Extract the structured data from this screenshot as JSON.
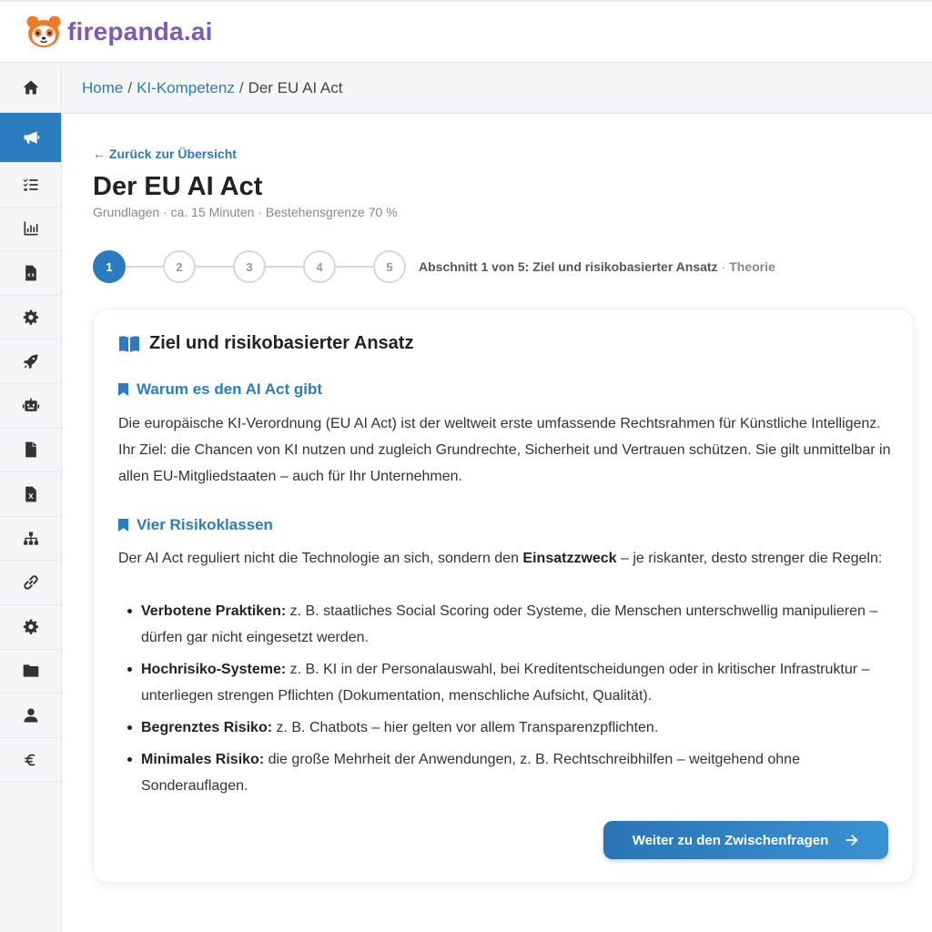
{
  "brand": {
    "name_part1": "fire",
    "name_part2": "panda",
    "name_part3": ".ai",
    "color": "#7a5bb5"
  },
  "breadcrumb": {
    "home": "Home",
    "section": "KI-Kompetenz",
    "current": "Der EU AI Act",
    "separator": "/"
  },
  "sidebar": {
    "items": [
      {
        "icon": "home-icon"
      },
      {
        "icon": "megaphone-icon",
        "active": true
      },
      {
        "icon": "checklist-icon"
      },
      {
        "icon": "bar-chart-icon"
      },
      {
        "icon": "file-code-icon"
      },
      {
        "icon": "gear-icon"
      },
      {
        "icon": "rocket-icon"
      },
      {
        "icon": "robot-icon"
      },
      {
        "icon": "file-icon"
      },
      {
        "icon": "file-excel-icon"
      },
      {
        "icon": "sitemap-icon"
      },
      {
        "icon": "link-icon"
      },
      {
        "icon": "gear-icon"
      },
      {
        "icon": "folder-icon"
      },
      {
        "icon": "user-icon"
      },
      {
        "icon": "euro-icon"
      }
    ]
  },
  "lesson": {
    "back_label": "← Zurück zur Übersicht",
    "title": "Der EU AI Act",
    "meta": "Grundlagen · ca. 15 Minuten · Bestehensgrenze 70 %",
    "steps": [
      "1",
      "2",
      "3",
      "4",
      "5"
    ],
    "active_step": 1,
    "step_caption": "Abschnitt 1 von 5: Ziel und risikobasierter Ansatz",
    "step_separator": "·",
    "step_type": "Theorie"
  },
  "card": {
    "title": "Ziel und risikobasierter Ansatz",
    "section1": {
      "heading": "Warum es den AI Act gibt",
      "text": "Die europäische KI-Verordnung (EU AI Act) ist der weltweit erste umfassende Rechtsrahmen für Künstliche Intelligenz. Ihr Ziel: die Chancen von KI nutzen und zugleich Grundrechte, Sicherheit und Vertrauen schützen. Sie gilt unmittelbar in allen EU-Mitgliedstaaten – auch für Ihr Unternehmen."
    },
    "section2": {
      "heading": "Vier Risikoklassen",
      "intro_before": "Der AI Act reguliert nicht die Technologie an sich, sondern den ",
      "intro_bold": "Einsatzzweck",
      "intro_after": " – je riskanter, desto strenger die Regeln:",
      "items": [
        {
          "term": "Verbotene Praktiken:",
          "text": " z. B. staatliches Social Scoring oder Systeme, die Menschen unterschwellig manipulieren – dürfen gar nicht eingesetzt werden."
        },
        {
          "term": "Hochrisiko-Systeme:",
          "text": " z. B. KI in der Personalauswahl, bei Kreditentscheidungen oder in kritischer Infrastruktur – unterliegen strengen Pflichten (Dokumentation, menschliche Aufsicht, Qualität)."
        },
        {
          "term": "Begrenztes Risiko:",
          "text": " z. B. Chatbots – hier gelten vor allem Transparenzpflichten."
        },
        {
          "term": "Minimales Risiko:",
          "text": " die große Mehrheit der Anwendungen, z. B. Rechtschreibhilfen – weitgehend ohne Sonderauflagen."
        }
      ]
    },
    "cta_label": "Weiter zu den Zwischenfragen"
  },
  "colors": {
    "accent": "#2b7bbf",
    "muted": "#888888"
  }
}
